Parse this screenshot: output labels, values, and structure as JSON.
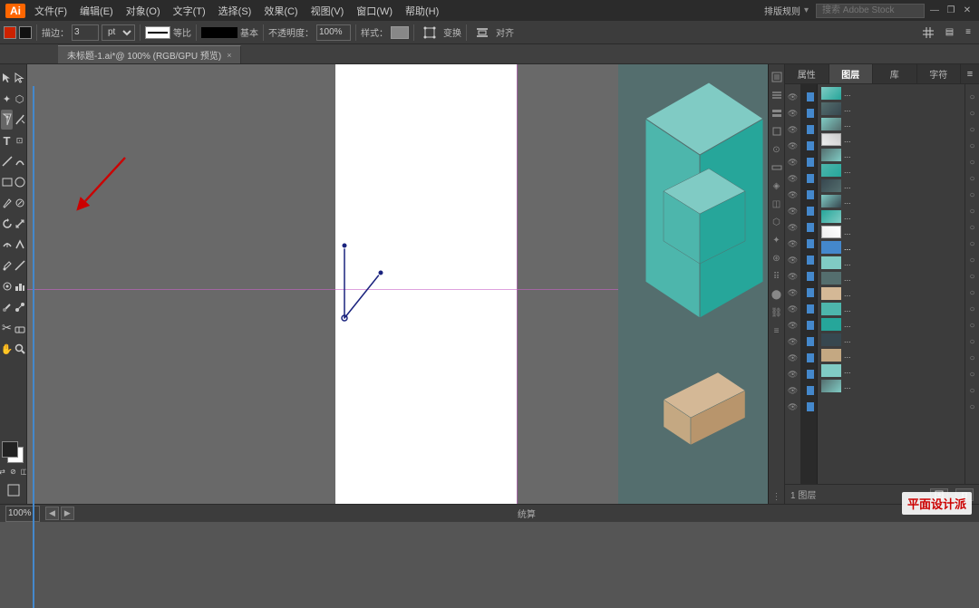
{
  "app": {
    "logo": "Ai",
    "title": "未标题-1.ai*@ 100% (RGB/GPU 预览)",
    "tab_close": "×"
  },
  "menu": {
    "items": [
      "文件(F)",
      "编辑(E)",
      "对象(O)",
      "文字(T)",
      "选择(S)",
      "效果(C)",
      "视图(V)",
      "窗口(W)",
      "帮助(H)"
    ]
  },
  "titlebar": {
    "arrange_label": "排版规则",
    "search_placeholder": "搜索 Adobe Stock",
    "win_minimize": "—",
    "win_restore": "❐",
    "win_close": "✕"
  },
  "toolbar1": {
    "stroke_label": "描边：",
    "pt_value": "3",
    "pt_unit": "pt",
    "equal_label": "等比",
    "basic_label": "基本",
    "opacity_label": "不透明度：",
    "opacity_value": "100%",
    "style_label": "样式：",
    "transform_label": "变换",
    "align_label": "对齐"
  },
  "panels": {
    "tabs": [
      "属性",
      "图层",
      "库",
      "字符"
    ],
    "expand_icon": "≡",
    "layers": [
      {
        "color": "#4488cc",
        "dots": "..."
      },
      {
        "color": "#4488cc",
        "dots": "..."
      },
      {
        "color": "#4488cc",
        "dots": "..."
      },
      {
        "color": "#4488cc",
        "dots": "..."
      },
      {
        "color": "#4488cc",
        "dots": "..."
      },
      {
        "color": "#4488cc",
        "dots": "..."
      },
      {
        "color": "#4488cc",
        "dots": "..."
      },
      {
        "color": "#4488cc",
        "dots": "..."
      },
      {
        "color": "#4488cc",
        "dots": "..."
      },
      {
        "color": "#4488cc",
        "dots": "..."
      },
      {
        "color": "#4488cc",
        "dots": "..."
      },
      {
        "color": "#4488cc",
        "dots": "..."
      },
      {
        "color": "#4488cc",
        "dots": "..."
      },
      {
        "color": "#4488cc",
        "dots": "..."
      },
      {
        "color": "#4488cc",
        "dots": "..."
      },
      {
        "color": "#4488cc",
        "dots": "..."
      },
      {
        "color": "#4488cc",
        "dots": "..."
      },
      {
        "color": "#4488cc",
        "dots": "..."
      },
      {
        "color": "#4488cc",
        "dots": "..."
      },
      {
        "color": "#4488cc",
        "dots": "..."
      }
    ]
  },
  "statusbar": {
    "zoom": "100%",
    "status_text": "统算"
  },
  "bottom_panel": {
    "layers_label": "1 图层",
    "btn1": "□"
  },
  "watermark": {
    "text": "平面设计派"
  },
  "tools": {
    "select": "▸",
    "direct_select": "▷",
    "group_select": "◈",
    "lasso": "⬡",
    "pen": "✒",
    "pen_add": "+",
    "pen_del": "−",
    "anchor": "◇",
    "type": "T",
    "type_area": "⊡",
    "line": "╲",
    "arc": "⌒",
    "rect": "□",
    "ellipse": "○",
    "brush": "✦",
    "pencil": "✏",
    "blob": "◉",
    "rotate": "↻",
    "scale": "⤡",
    "warp": "⟟",
    "width": "⟺",
    "eyedropper": "✦",
    "measure": "📏",
    "symbol": "⊛",
    "column_chart": "▐",
    "art_brush": "⊘",
    "blend": "⊕",
    "scissors": "✂",
    "eraser": "⬜",
    "hand": "✋",
    "zoom_tool": "🔍"
  }
}
